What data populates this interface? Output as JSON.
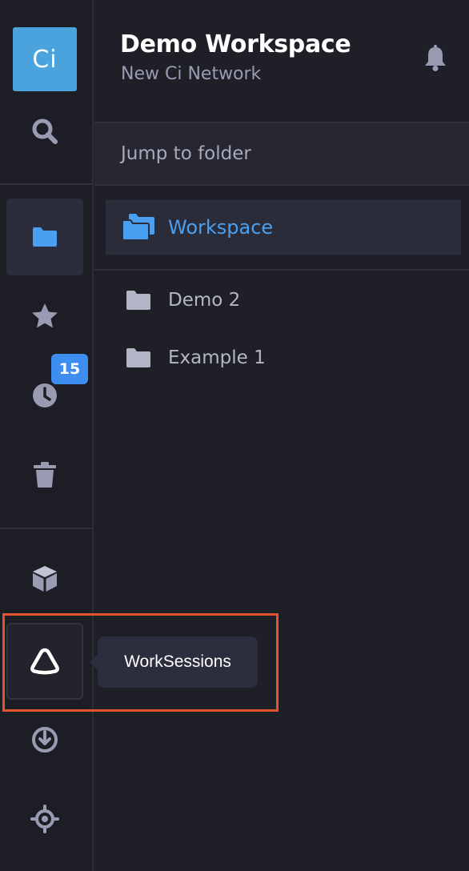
{
  "logo": {
    "text": "Ci"
  },
  "workspace": {
    "title": "Demo Workspace",
    "subtitle": "New Ci Network"
  },
  "search": {
    "placeholder": "Jump to folder"
  },
  "tree": {
    "root": {
      "label": "Workspace"
    },
    "folders": [
      {
        "label": "Demo 2"
      },
      {
        "label": "Example 1"
      }
    ]
  },
  "rail": {
    "items": [
      {
        "name": "search",
        "icon": "search-icon"
      },
      {
        "name": "files",
        "icon": "folder-icon",
        "active": true
      },
      {
        "name": "favorites",
        "icon": "star-icon"
      },
      {
        "name": "recent",
        "icon": "clock-icon",
        "badge": "15"
      },
      {
        "name": "trash",
        "icon": "trash-icon"
      },
      {
        "name": "packages",
        "icon": "cube-icon"
      },
      {
        "name": "worksessions",
        "icon": "worksessions-icon"
      },
      {
        "name": "download",
        "icon": "download-icon"
      },
      {
        "name": "settings",
        "icon": "target-icon"
      }
    ],
    "recent_badge": "15"
  },
  "tooltip": {
    "text": "WorkSessions"
  },
  "colors": {
    "background": "#1f2027",
    "accent": "#4a9ff0",
    "logo": "#4aa3dc",
    "badge": "#3d8ef0",
    "highlight": "#e5522f"
  }
}
